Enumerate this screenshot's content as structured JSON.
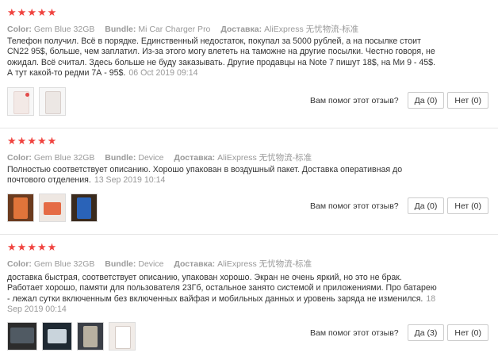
{
  "labels": {
    "color": "Color:",
    "bundle": "Bundle:",
    "shipping": "Доставка:",
    "helpful_question": "Вам помог этот отзыв?"
  },
  "colors": {
    "star": "#f0433f",
    "muted": "#999999",
    "text": "#333333"
  },
  "reviews": [
    {
      "rating": 5,
      "color": "Gem Blue 32GB",
      "bundle": "Mi Car Charger Pro",
      "shipping": "AliExpress 无忧物流-标准",
      "text": "Телефон получил. Всё в порядке. Единственный недостаток, покупал за 5000 рублей, а на посылке стоит CN22 95$, больше, чем заплатил. Из-за этого могу влететь на таможне на другие посылки. Честно говоря, не ожидал. Всё считал. Здесь больше не буду заказывать. Другие продавцы на Note 7 пишут 18$, на Ми 9 - 45$. А тут какой-то редми 7А - 95$.",
      "date": "06 Oct 2019 09:14",
      "yes": "Да (0)",
      "no": "Нет (0)"
    },
    {
      "rating": 5,
      "color": "Gem Blue 32GB",
      "bundle": "Device",
      "shipping": "AliExpress 无忧物流-标准",
      "text": "Полностью соответствует описанию. Хорошо упакован в воздушный пакет. Доставка оперативная до почтового отделения.",
      "date": "13 Sep 2019 10:14",
      "yes": "Да (0)",
      "no": "Нет (0)"
    },
    {
      "rating": 5,
      "color": "Gem Blue 32GB",
      "bundle": "Device",
      "shipping": "AliExpress 无忧物流-标准",
      "text": "доставка быстрая, соответствует описанию, упакован хорошо. Экран не очень яркий, но это не брак. Работает хорошо, памяти для пользователя 23Гб, остальное занято системой и приложениями. Про батарею - лежал сутки включенным без включенных вайфая и мобильных данных и уровень заряда не изменился.",
      "date": "18 Sep 2019 00:14",
      "yes": "Да (3)",
      "no": "Нет (0)"
    }
  ]
}
